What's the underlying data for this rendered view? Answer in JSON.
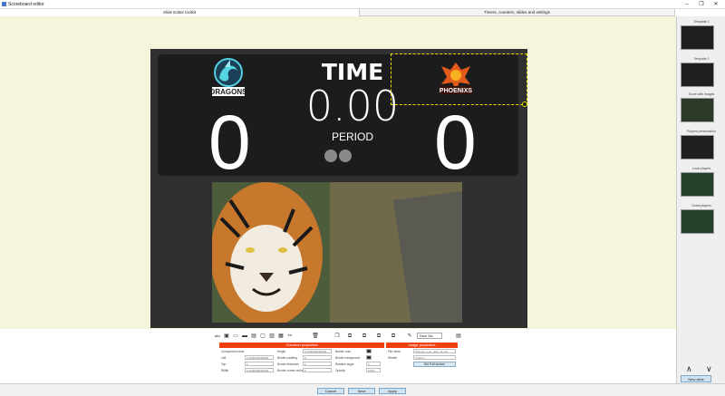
{
  "window": {
    "title": "Scoreboard editor",
    "minimize": "–",
    "maximize": "❐",
    "close": "✕"
  },
  "tabs": [
    {
      "label": "Slide Editor toolkit",
      "active": true
    },
    {
      "label": "Timers, counters, slides and settings",
      "active": false
    }
  ],
  "scoreboard": {
    "title": "TIME",
    "time": "0.00",
    "period_label": "PERIOD",
    "home_score": "0",
    "away_score": "0",
    "home_team": "DRAGONS",
    "away_team": "PHOENIXS"
  },
  "sidebar": {
    "templates": [
      {
        "label": "Template 1"
      },
      {
        "label": "Template 2"
      },
      {
        "label": "Score with images"
      },
      {
        "label": "Players presentation"
      },
      {
        "label": "Local players"
      },
      {
        "label": "Guest players"
      }
    ],
    "up_arrow": "∧",
    "down_arrow": "∨",
    "new_slide": "New slide"
  },
  "toolbar": {
    "text_tool": "abc",
    "ratio": "Each 16x"
  },
  "properties": {
    "common_title": "Common properties",
    "image_title": "Image properties",
    "component_name_label": "Component name",
    "left_label": "Left",
    "top_label": "Top",
    "width_label": "Width",
    "height_label": "Height",
    "border_padding_label": "Border padding",
    "border_thickness_label": "Border thickness",
    "border_corner_label": "Border corner radius",
    "border_color_label": "Border color",
    "border_background_label": "Border background",
    "rotation_angle_label": "Rotation angle",
    "opacity_label": "Opacity",
    "component_name_value": "",
    "left_value": "0,1000000000000",
    "top_value": "0",
    "width_value": "0,1000000000000",
    "height_value": "0,1000000000000",
    "border_padding_value": "0",
    "border_thickness_value": "0",
    "border_corner_value": "0",
    "rotation_angle_value": "0",
    "opacity_value": "100%",
    "file_name_label": "File name",
    "stretch_label": "Stretch",
    "file_name_value": "Phoenix_logo_gold_2k.png",
    "stretch_value": "Uniform",
    "set_full_screen": "Set Full screen"
  },
  "footer": {
    "cancel": "Cancel",
    "save": "Save",
    "apply": "Apply"
  }
}
